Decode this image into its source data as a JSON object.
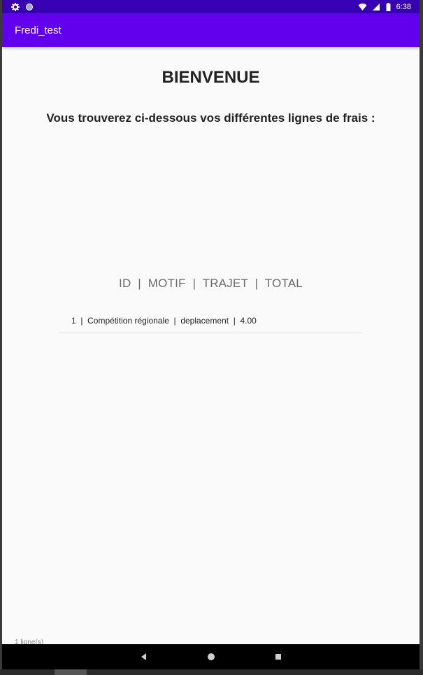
{
  "status_bar": {
    "time": "6:38",
    "icons_left": [
      "settings-icon",
      "notification-dot-icon"
    ],
    "icons_right": [
      "wifi-icon",
      "signal-icon",
      "battery-icon"
    ]
  },
  "app_bar": {
    "title": "Fredi_test"
  },
  "main": {
    "welcome": "BIENVENUE",
    "subtitle": "Vous trouverez ci-dessous vos différentes lignes de frais :",
    "table_header": "ID  |  MOTIF  |  TRAJET  |  TOTAL",
    "rows": [
      {
        "text": "1  |  Compétition régionale  |  deplacement  |  4.00"
      }
    ],
    "count": "1 ligne(s)"
  },
  "nav_bar": {
    "buttons": [
      "back-icon",
      "home-icon",
      "recents-icon"
    ]
  },
  "colors": {
    "status_bar": "#3700b3",
    "app_bar": "#6200ee",
    "background": "#fafafa"
  }
}
